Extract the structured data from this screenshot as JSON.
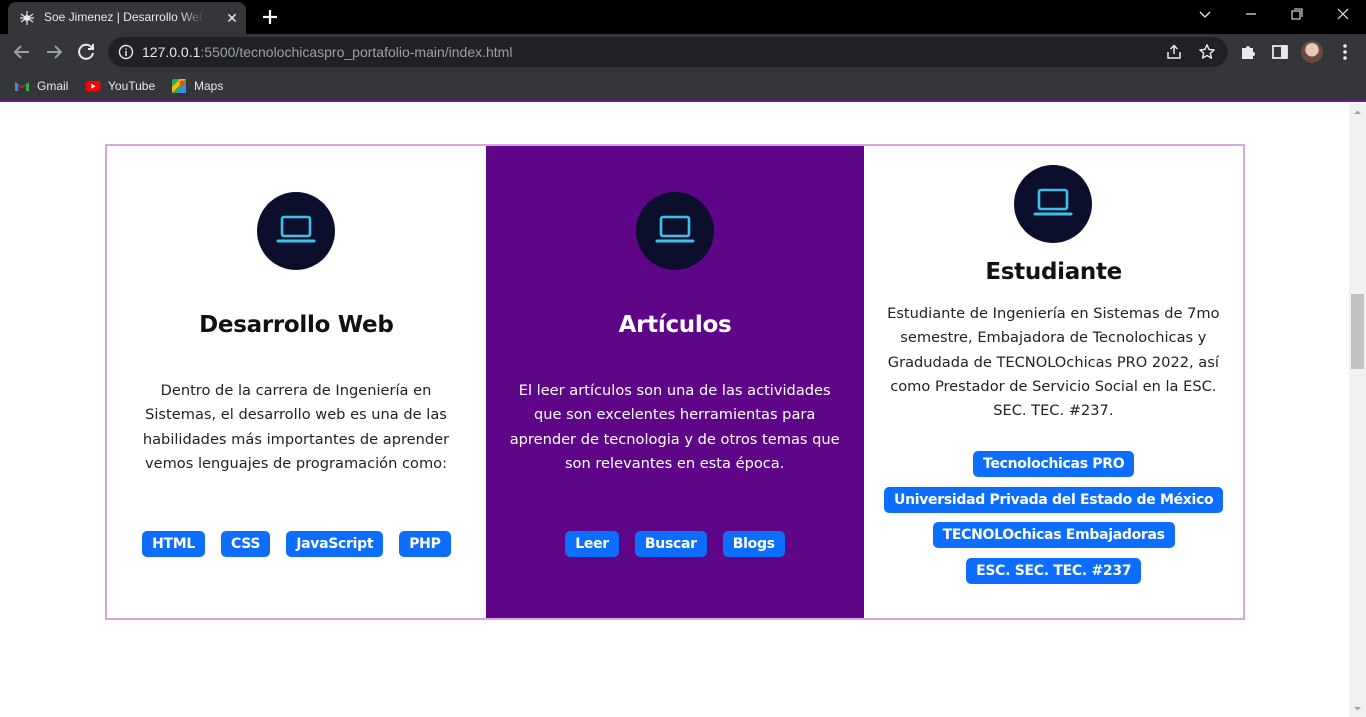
{
  "browser": {
    "tab": {
      "title": "Soe Jimenez | Desarrollo Web Front",
      "favicon": "spider-favicon-icon",
      "close_icon": "close-icon"
    },
    "newtab_icon": "plus-icon",
    "window_controls": [
      "chevron-down-icon",
      "minimize-icon",
      "restore-icon",
      "close-icon"
    ],
    "url": {
      "host": "127.0.0.1",
      "rest": ":5500/tecnolochicaspro_portafolio-main/index.html"
    },
    "nav_icons": [
      "back-arrow-icon",
      "forward-arrow-icon",
      "reload-icon"
    ],
    "omnibox_icons": [
      "info-icon",
      "share-icon",
      "star-icon"
    ],
    "toolbar_icons": [
      "extensions-puzzle-icon",
      "side-panel-icon",
      "profile-avatar",
      "kebab-menu-icon"
    ],
    "bookmarks": [
      {
        "label": "Gmail",
        "icon": "gmail-icon"
      },
      {
        "label": "YouTube",
        "icon": "youtube-icon"
      },
      {
        "label": "Maps",
        "icon": "maps-icon"
      }
    ]
  },
  "cards": [
    {
      "icon": "laptop-icon",
      "title": "Desarrollo Web",
      "text": "Dentro de la carrera de Ingeniería en Sistemas, el desarrollo web es una de las habilidades más importantes de aprender vemos lenguajes de programación como:",
      "tags": [
        "HTML",
        "CSS",
        "JavaScript",
        "PHP"
      ]
    },
    {
      "icon": "laptop-icon",
      "title": "Artículos",
      "text": "El leer artículos son una de las actividades que son excelentes herramientas para aprender de tecnologia y de otros temas que son relevantes en esta época.",
      "tags": [
        "Leer",
        "Buscar",
        "Blogs"
      ]
    },
    {
      "icon": "laptop-icon",
      "title": "Estudiante",
      "text": "Estudiante de Ingeniería en Sistemas de 7mo semestre, Embajadora de Tecnolochicas y Gradudada de TECNOLOchicas PRO 2022, así como Prestador de Servicio Social en la ESC. SEC. TEC. #237.",
      "tags": [
        "Tecnolochicas PRO",
        "Universidad Privada del Estado de México",
        "TECNOLOchicas Embajadoras",
        "ESC. SEC. TEC. #237"
      ]
    }
  ],
  "colors": {
    "accent_purple": "#5e0687",
    "card_border": "#d7a6e0",
    "tag_blue": "#0d6efd",
    "icon_circle": "#0b0f2c",
    "icon_stroke": "#3ec1e8"
  }
}
